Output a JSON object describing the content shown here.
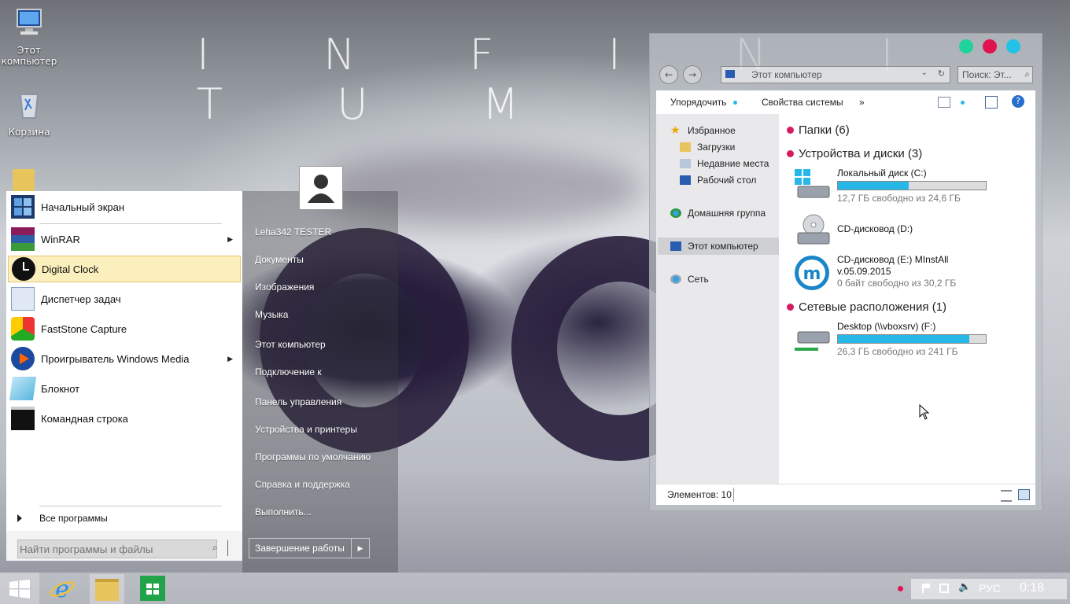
{
  "wallpaper": {
    "title": "I N F I N I T U M"
  },
  "desktop": {
    "icons": [
      {
        "label": "Этот компьютер"
      },
      {
        "label": "Корзина"
      }
    ]
  },
  "start_menu": {
    "pinned": [
      {
        "label": "Начальный экран",
        "icon": "start-screen-icon"
      },
      {
        "label": "WinRAR",
        "icon": "winrar-icon",
        "has_submenu": true
      },
      {
        "label": "Digital Clock",
        "icon": "clock-icon",
        "highlighted": true
      },
      {
        "label": "Диспетчер задач",
        "icon": "task-manager-icon"
      },
      {
        "label": "FastStone Capture",
        "icon": "faststone-icon"
      },
      {
        "label": "Проигрыватель Windows Media",
        "icon": "media-player-icon",
        "has_submenu": true
      },
      {
        "label": "Блокнот",
        "icon": "notepad-icon"
      },
      {
        "label": "Командная строка",
        "icon": "cmd-icon"
      }
    ],
    "all_programs": "Все программы",
    "search_placeholder": "Найти программы и файлы",
    "user_name": "Leha342 TESTER",
    "right_items": [
      "Документы",
      "Изображения",
      "Музыка",
      "Этот компьютер",
      "Подключение к",
      "Панель управления",
      "Устройства и принтеры",
      "Программы по умолчанию",
      "Справка и поддержка",
      "Выполнить..."
    ],
    "shutdown_label": "Завершение работы"
  },
  "explorer": {
    "address": "Этот компьютер",
    "search_placeholder": "Поиск: Эт...",
    "toolbar": {
      "organize": "Упорядочить",
      "system_props": "Свойства системы",
      "more": "»"
    },
    "nav": {
      "favorites": "Избранное",
      "downloads": "Загрузки",
      "recent": "Недавние места",
      "desktop": "Рабочий стол",
      "homegroup": "Домашняя группа",
      "this_pc": "Этот компьютер",
      "network": "Сеть"
    },
    "groups": {
      "folders": "Папки (6)",
      "devices": "Устройства и диски (3)",
      "network": "Сетевые расположения (1)"
    },
    "drives": [
      {
        "name": "Локальный диск (C:)",
        "free": "12,7 ГБ свободно из 24,6 ГБ",
        "used_fraction": 0.48
      },
      {
        "name": "CD-дисковод (D:)"
      },
      {
        "name": "CD-дисковод (E:) MInstAll",
        "name2": "v.05.09.2015",
        "free": "0 байт свободно из 30,2 ГБ"
      },
      {
        "name": "Desktop (\\\\vboxsrv) (F:)",
        "free": "26,3 ГБ свободно из 241 ГБ",
        "used_fraction": 0.89
      }
    ],
    "status": "Элементов: 10",
    "window_dots": [
      "#1fd39a",
      "#e0134f",
      "#22c3e6"
    ]
  },
  "taskbar": {
    "lang": "РУС",
    "time": "0:18"
  }
}
